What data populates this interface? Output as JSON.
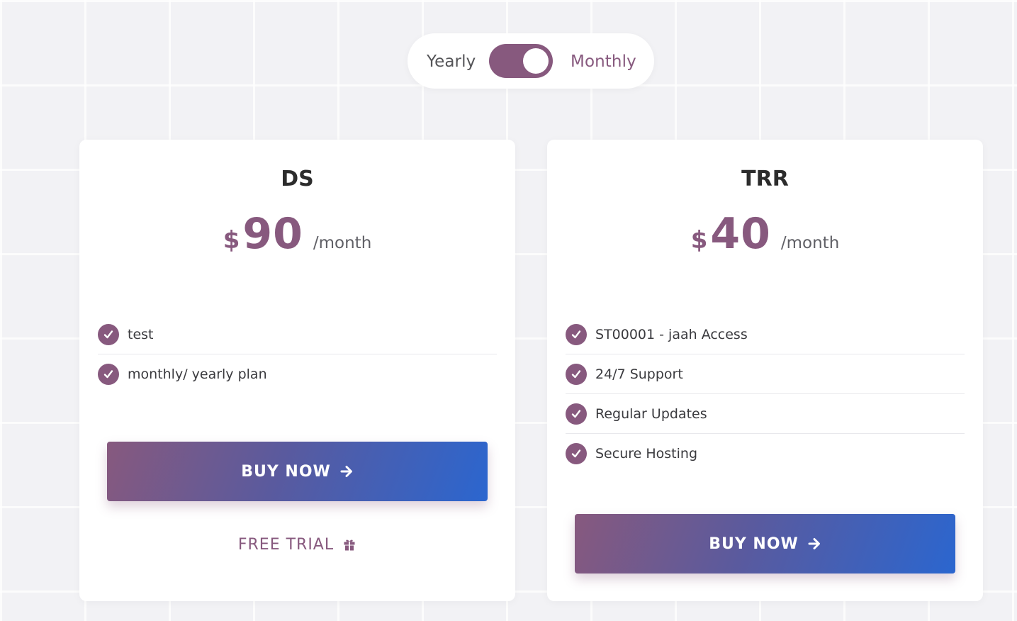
{
  "billing_toggle": {
    "yearly_label": "Yearly",
    "monthly_label": "Monthly",
    "selected": "Monthly"
  },
  "plans": [
    {
      "name": "DS",
      "currency": "$",
      "price": "90",
      "period": "/month",
      "features": [
        "test",
        "monthly/ yearly plan"
      ],
      "buy_label": "BUY NOW",
      "trial_label": "FREE TRIAL"
    },
    {
      "name": "TRR",
      "currency": "$",
      "price": "40",
      "period": "/month",
      "features": [
        "ST00001 - jaah Access",
        "24/7 Support",
        "Regular Updates",
        "Secure Hosting"
      ],
      "buy_label": "BUY NOW"
    }
  ],
  "icons": {
    "check": "check-circle-icon",
    "buy": "arrow-right-icon",
    "trial": "gift-icon"
  },
  "colors": {
    "accent": "#87597e",
    "button_gradient_start": "#87597e",
    "button_gradient_end": "#2b66cf",
    "background": "#f2f2f5"
  }
}
